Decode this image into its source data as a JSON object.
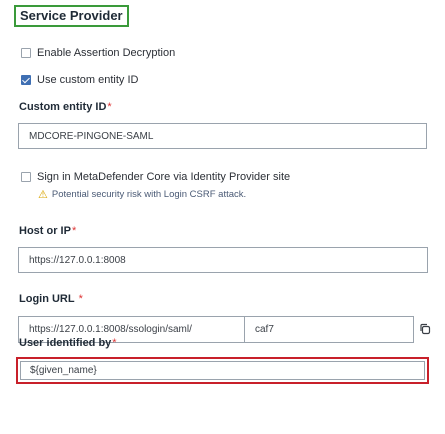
{
  "section": {
    "title": "Service Provider"
  },
  "checkboxes": {
    "assertion_decryption": {
      "label": "Enable Assertion Decryption",
      "checked": false
    },
    "custom_entity": {
      "label": "Use custom entity ID",
      "checked": true
    },
    "idp_signin": {
      "label": "Sign in MetaDefender Core via Identity Provider site",
      "checked": false
    }
  },
  "custom_entity_id": {
    "label": "Custom entity ID",
    "required_mark": "*",
    "value": "MDCORE-PINGONE-SAML"
  },
  "idp_warning": {
    "icon": "warning-icon",
    "text": "Potential security risk with Login CSRF attack."
  },
  "host": {
    "label": "Host or IP",
    "required_mark": "*",
    "value": "https://127.0.0.1:8008"
  },
  "login_url": {
    "label": "Login URL",
    "required_mark": "*",
    "url": "https://127.0.0.1:8008/ssologin/saml/",
    "suffix": "caf7",
    "copy_icon": "copy-icon"
  },
  "user_identified": {
    "label": "User identified by",
    "required_mark": "*",
    "value": "${given_name}"
  },
  "colors": {
    "accent_green": "#3a9a3a",
    "checkbox_blue": "#3f6fb3",
    "error_red": "#c8202a",
    "warning_yellow": "#d9a400"
  }
}
